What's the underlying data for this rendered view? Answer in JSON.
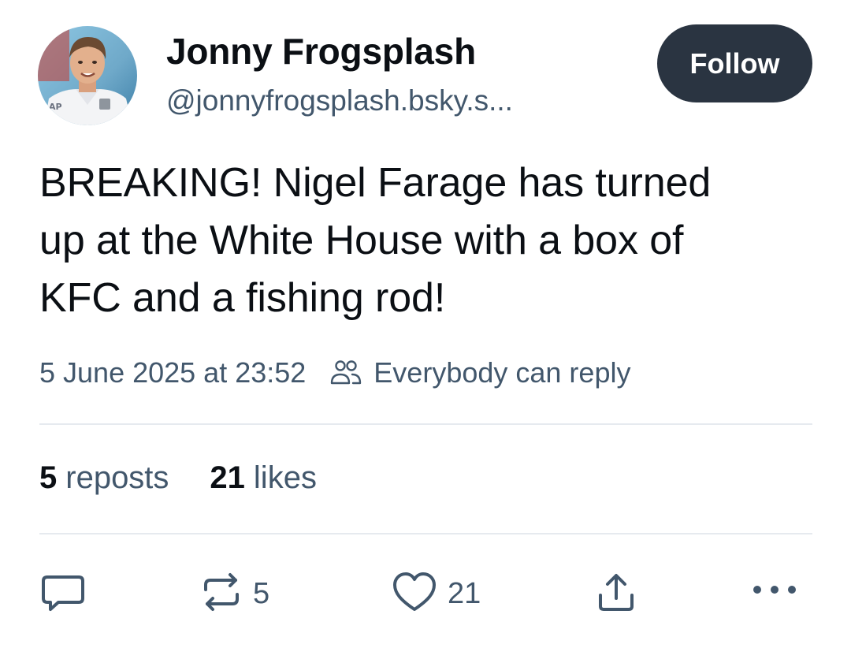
{
  "author": {
    "display_name": "Jonny Frogsplash",
    "handle": "@jonnyfrogsplash.bsky.s...",
    "avatar_jersey_text": "AP"
  },
  "follow_button": {
    "label": "Follow"
  },
  "post": {
    "text_lines": [
      "BREAKING! Nigel Farage has turned",
      "up at the White House with a box of",
      "KFC and a fishing rod!"
    ],
    "timestamp": "5 June 2025 at 23:52",
    "reply_setting": "Everybody can reply",
    "reply_icon": "people-icon"
  },
  "stats": {
    "reposts_count": "5",
    "reposts_label": "reposts",
    "likes_count": "21",
    "likes_label": "likes"
  },
  "actions": {
    "reply_icon": "comment-icon",
    "repost_icon": "repost-icon",
    "repost_count": "5",
    "like_icon": "heart-icon",
    "like_count": "21",
    "share_icon": "share-icon",
    "more_icon": "more-icon"
  },
  "colors": {
    "text_primary": "#0b0f14",
    "text_secondary": "#42576c",
    "follow_button_bg": "#2a3441",
    "divider": "#e6eaef"
  }
}
